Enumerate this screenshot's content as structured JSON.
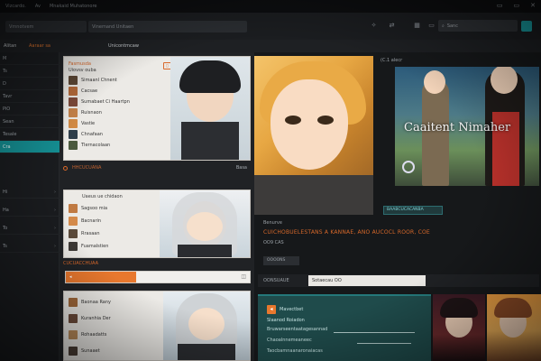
{
  "titlebar": {
    "items": [
      "Vizcardo.",
      "Av",
      "Mnakaid Muhatonore"
    ],
    "controls": [
      "▭",
      "▭",
      "✕"
    ]
  },
  "toolbar": {
    "address": "Vmnotvem",
    "query": "Vinemand Unitaen",
    "search_placeholder": "Sanc"
  },
  "tabrow": {
    "left": "Alitan",
    "mid": "Aaraar sa",
    "right": "Unicontmcaw"
  },
  "sidebar": {
    "items": [
      "M",
      "Ts",
      "D",
      "Tavr",
      "PiO",
      "Sean",
      "Tesale",
      "Cra",
      "Hi",
      "Ha",
      "To",
      "Ts"
    ],
    "active_index": 7
  },
  "col1": {
    "card1": {
      "head1": "Fasmusda",
      "head2": "Uiovsv ouba",
      "rows": [
        "Simaanl Chnent",
        "Cacsae",
        "Sumabaet Ci Haartpn",
        "Ruisnaon",
        "Vastie",
        "Chnafaan",
        "Tlernacolaan"
      ]
    },
    "sep1": {
      "label": "HHCUCUANA",
      "right": "Basa"
    },
    "card2": {
      "head": "Uaeus ue chidaon",
      "rows": [
        "Sagsoo mia",
        "Bacnarin",
        "Rrasaan",
        "Fuamalstien"
      ]
    },
    "orange_bar": {
      "label": "CUCUACCHUAA",
      "icon": "◫"
    },
    "card3": {
      "rows": [
        "Baonaa Rany",
        "Kuranhia Der",
        "Rohaadatts",
        "Sunaaet"
      ]
    }
  },
  "col2": {
    "top_label": "(C.1 alecr",
    "hero_caption": "Caaitent Nimaher",
    "chip": "BAABCUCACANBA",
    "info_label": "Benurve",
    "info_title": "CUICHOBUELESTANS A KANNAE, ANO AUCOCL ROOR, COE",
    "info_sub": "OO9 CAS",
    "btn": "OOOONS",
    "search": {
      "label": "OONSUAUE",
      "value": "Sotaecau OO"
    },
    "teal": {
      "title": "Mavectbet",
      "rows": [
        "Slaanod Roiadon",
        "Bruwarseentaatagesannad",
        "Chaoalnnemeaneec",
        "Taocbamnaanaronaiacas"
      ]
    }
  }
}
